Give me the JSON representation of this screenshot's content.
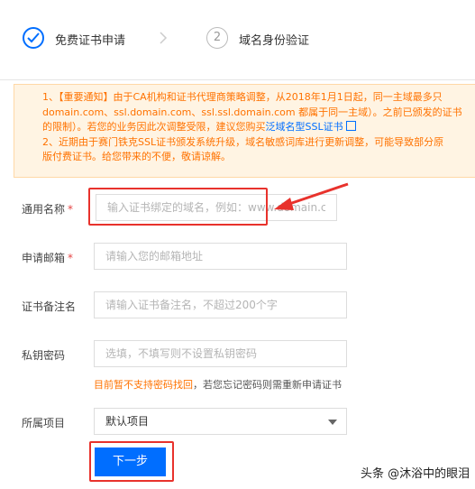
{
  "steps": [
    {
      "number": "",
      "label": "免费证书申请"
    },
    {
      "number": "2",
      "label": "域名身份验证"
    }
  ],
  "notice": {
    "line1": "1、【重要通知】由于CA机构和证书代理商策略调整，从2018年1月1日起，同一主域最多只",
    "line2": "domain.com、ssl.domain.com、ssl.ssl.domain.com 都属于同一主域）。之前已颁发的证书",
    "line3_text": "的限制）。若您的业务因此次调整受限，建议您购买",
    "line3_link": "泛域名型SSL证书",
    "line4": "2、近期由于赛门铁克SSL证书颁发系统升级，域名敏感词库进行更新调整，可能导致部分原",
    "line5": "版付费证书。给您带来的不便，敬请谅解。"
  },
  "form": {
    "common_name": {
      "label": "通用名称",
      "required": "*",
      "placeholder": "输入证书绑定的域名，例如：www.domain.com"
    },
    "email": {
      "label": "申请邮箱",
      "required": "*",
      "placeholder": "请输入您的邮箱地址"
    },
    "remark": {
      "label": "证书备注名",
      "placeholder": "请输入证书备注名，不超过200个字"
    },
    "key_password": {
      "label": "私钥密码",
      "placeholder": "选填，不填写则不设置私钥密码"
    },
    "password_warning_highlight": "目前暂不支持密码找回",
    "password_warning_rest": "，若您忘记密码则需重新申请证书",
    "project": {
      "label": "所属项目",
      "selected": "默认项目"
    }
  },
  "next_button": "下一步",
  "watermark": "头条 @沐浴中的眼泪",
  "colors": {
    "primary": "#006eff",
    "annotation": "#e8322c",
    "warning": "#ff7200",
    "notice_bg": "#fff4e3"
  }
}
